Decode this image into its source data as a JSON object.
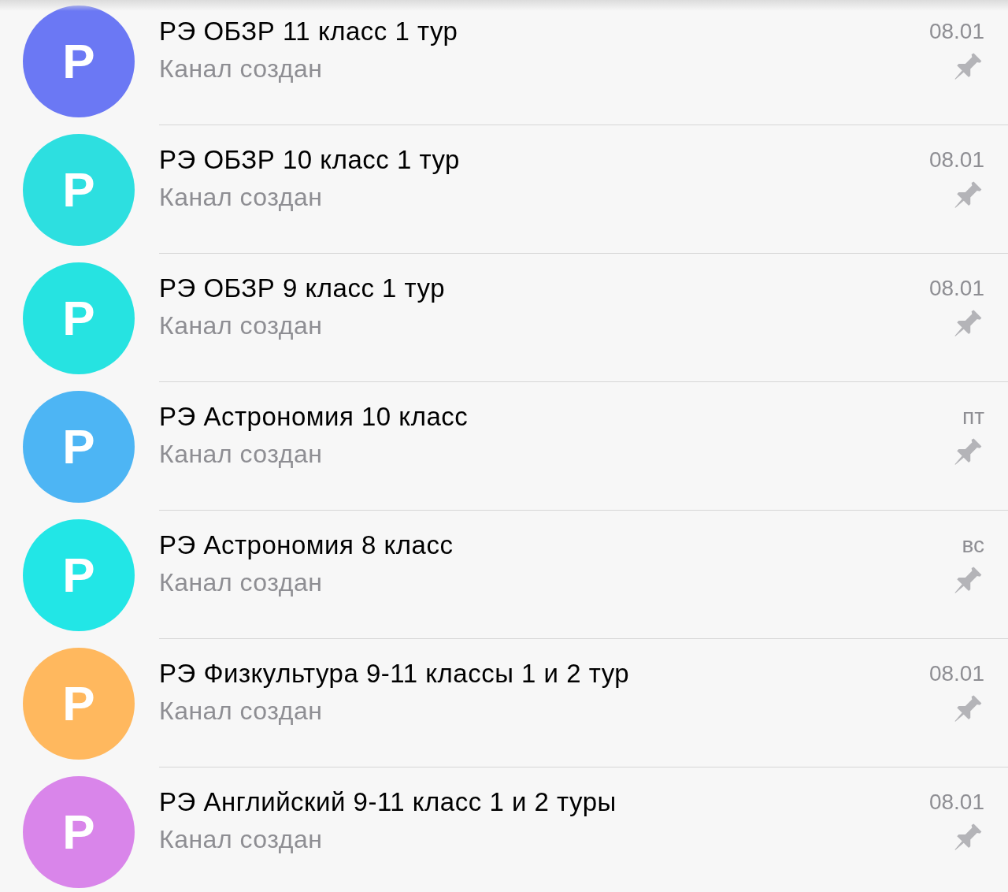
{
  "chats": [
    {
      "avatar_letter": "Р",
      "color": "#6b78f4",
      "title": "РЭ ОБЗР 11 класс 1 тур",
      "subtitle": "Канал создан",
      "date": "08.01",
      "pinned": true
    },
    {
      "avatar_letter": "Р",
      "color": "#2ddfe0",
      "title": "РЭ ОБЗР 10 класс 1 тур",
      "subtitle": "Канал создан",
      "date": "08.01",
      "pinned": true
    },
    {
      "avatar_letter": "Р",
      "color": "#26e3e1",
      "title": "РЭ ОБЗР 9 класс 1 тур",
      "subtitle": "Канал создан",
      "date": "08.01",
      "pinned": true
    },
    {
      "avatar_letter": "Р",
      "color": "#4db5f4",
      "title": "РЭ Астрономия 10 класс",
      "subtitle": "Канал создан",
      "date": "пт",
      "pinned": true
    },
    {
      "avatar_letter": "Р",
      "color": "#22e6e6",
      "title": "РЭ Астрономия 8 класс",
      "subtitle": "Канал создан",
      "date": "вс",
      "pinned": true
    },
    {
      "avatar_letter": "Р",
      "color": "#ffb85e",
      "title": "РЭ Физкультура 9-11 классы 1 и 2 тур",
      "subtitle": "Канал создан",
      "date": "08.01",
      "pinned": true
    },
    {
      "avatar_letter": "Р",
      "color": "#d985ea",
      "title": "РЭ Английский 9-11 класс 1 и 2 туры",
      "subtitle": "Канал создан",
      "date": "08.01",
      "pinned": true
    }
  ]
}
